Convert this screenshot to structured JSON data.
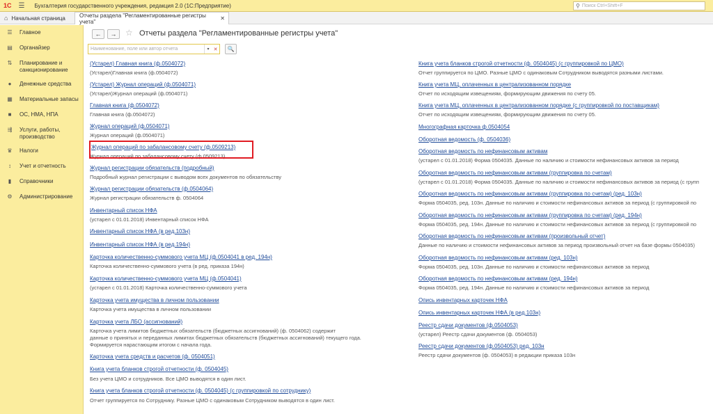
{
  "app": {
    "logo": "1С",
    "title": "Бухгалтерия государственного учреждения, редакция 2.0",
    "mode": "(1С:Предприятие)",
    "search_placeholder": "Поиск Ctrl+Shift+F"
  },
  "tabs": {
    "home": "Начальная страница",
    "active": "Отчеты раздела \"Регламентированные регистры учета\""
  },
  "sidebar": {
    "items": [
      {
        "label": "Главное",
        "icon": "hamburger-icon"
      },
      {
        "label": "Органайзер",
        "icon": "organizer-icon"
      },
      {
        "label": "Планирование и санкционирование",
        "icon": "planning-icon"
      },
      {
        "label": "Денежные средства",
        "icon": "money-icon"
      },
      {
        "label": "Материальные запасы",
        "icon": "materials-icon"
      },
      {
        "label": "ОС, НМА, НПА",
        "icon": "truck-icon"
      },
      {
        "label": "Услуги, работы, производство",
        "icon": "services-icon"
      },
      {
        "label": "Налоги",
        "icon": "taxes-icon"
      },
      {
        "label": "Учет и отчетность",
        "icon": "accounting-icon"
      },
      {
        "label": "Справочники",
        "icon": "book-icon"
      },
      {
        "label": "Администрирование",
        "icon": "gear-icon"
      }
    ]
  },
  "main": {
    "title": "Отчеты раздела \"Регламентированные регистры учета\"",
    "filter_placeholder": "Наименование, поле или автор отчета"
  },
  "left_column": [
    {
      "type": "link",
      "text": "(Устарел) Главная книга (ф.0504072)"
    },
    {
      "type": "desc",
      "text": "(Устарел)Главная книга (ф.0504072)"
    },
    {
      "type": "link",
      "text": "(Устарел) Журнал операций (ф.0504071)"
    },
    {
      "type": "desc",
      "text": "(Устарел)Журнал операций (ф.0504071)"
    },
    {
      "type": "link",
      "text": "Главная книга (ф.0504072)"
    },
    {
      "type": "desc",
      "text": "Главная книга (ф.0504072)"
    },
    {
      "type": "link",
      "text": "Журнал операций (ф.0504071)"
    },
    {
      "type": "desc",
      "text": "Журнал операций (ф.0504071)"
    },
    {
      "type": "link",
      "text": "Журнал операций по забалансовому счету (ф.0509213)"
    },
    {
      "type": "desc",
      "text": "Журнал операций по забалансовому счету (ф.0509213)"
    },
    {
      "type": "link",
      "text": "Журнал регистрации обязательств (подробный)"
    },
    {
      "type": "desc",
      "text": "Подробный журнал регистрации с выводом всех документов по обязательству"
    },
    {
      "type": "link",
      "text": "Журнал регистрации обязательств (ф.0504064)"
    },
    {
      "type": "desc",
      "text": "Журнал регистрации обязательств ф. 0504064"
    },
    {
      "type": "link",
      "text": "Инвентарный список НФА"
    },
    {
      "type": "desc",
      "text": "(устарел с 01.01.2018) Инвентарный список НФА"
    },
    {
      "type": "link",
      "text": "Инвентарный список НФА (в ред.103н)"
    },
    {
      "type": "link",
      "text": "Инвентарный список НФА (в ред.194н)"
    },
    {
      "type": "link",
      "text": "Карточка количественно-суммового учета МЦ  (ф.0504041 в ред. 194н)"
    },
    {
      "type": "desc",
      "text": "Карточка количественно-суммового учета (в ред. приказа 194н)"
    },
    {
      "type": "link",
      "text": "Карточка количественно-суммового учета МЦ  (ф.0504041)"
    },
    {
      "type": "desc",
      "text": "(устарел с 01.01.2018) Карточка количественно-суммового учета"
    },
    {
      "type": "link",
      "text": "Карточка учета имущества в личном пользовании"
    },
    {
      "type": "desc",
      "text": "Карточка учета имущества в личном пользовании"
    },
    {
      "type": "link",
      "text": "Карточка учета ЛБО (ассигнований)"
    },
    {
      "type": "desc",
      "text": "Карточка учета лимитов бюджетных обязательств (бюджетных ассигнований) (ф. 0504062) содержит"
    },
    {
      "type": "desc",
      "text": "данные о принятых и переданных лимитах бюджетных обязательств (бюджетных ассигнований) текущего года."
    },
    {
      "type": "desc",
      "text": "Формируется нарастающим итогом с начала года."
    },
    {
      "type": "link",
      "text": "Карточка учета средств и расчетов (ф. 0504051)"
    },
    {
      "type": "link",
      "text": "Книга учета бланков строгой отчетности (ф. 0504045)"
    },
    {
      "type": "desc",
      "text": "Без учета ЦМО и сотрудников. Все ЦМО выводятся в один лист."
    },
    {
      "type": "link",
      "text": "Книга учета бланков строгой отчетности (ф. 0504045) (с группировкой по сотруднику)"
    },
    {
      "type": "desc",
      "text": "Отчет группируется по Сотруднику. Разные ЦМО с одинаковым Сотрудником выводятся в один лист."
    }
  ],
  "right_column": [
    {
      "type": "link",
      "text": "Книга учета бланков строгой отчетности (ф. 0504045) (с группировкой по ЦМО)"
    },
    {
      "type": "desc",
      "text": "Отчет группируется по ЦМО. Разные ЦМО с одинаковым Сотрудником выводятся разными листами."
    },
    {
      "type": "link",
      "text": "Книга учета МЦ, оплаченных в централизованном порядке"
    },
    {
      "type": "desc",
      "text": "Отчет по исходящим извещениям, формирующим движения по счету 05."
    },
    {
      "type": "link",
      "text": "Книга учета МЦ, оплаченных в централизованном порядке (с группировкой по поставщикам)"
    },
    {
      "type": "desc",
      "text": "Отчет по исходящим извещениям, формирующим движения по счету 05."
    },
    {
      "type": "link",
      "text": "Многографная карточка ф.0504054"
    },
    {
      "type": "link",
      "text": "Оборотная ведомость (ф. 0504036)"
    },
    {
      "type": "link",
      "text": "Оборотная ведомость по нефинансовым активам"
    },
    {
      "type": "desc",
      "text": "(устарел с 01.01.2018) Форма 0504035. Данные по наличию и стоимости нефинансовых активов за период"
    },
    {
      "type": "link",
      "text": "Оборотная ведомость по нефинансовым активам (группировка по счетам)"
    },
    {
      "type": "desc",
      "text": "(устарел с 01.01.2018) Форма 0504035. Данные по наличию и стоимости нефинансовых активов за период (с групп"
    },
    {
      "type": "link",
      "text": "Оборотная ведомость по нефинансовым активам (группировка по счетам) (ред. 103н)"
    },
    {
      "type": "desc",
      "text": "Форма 0504035, ред. 103н. Данные по наличию и стоимости нефинансовых активов за период (с группировкой по"
    },
    {
      "type": "link",
      "text": "Оборотная ведомость по нефинансовым активам (группировка по счетам) (ред. 194н)"
    },
    {
      "type": "desc",
      "text": "Форма 0504035, ред. 194н. Данные по наличию и стоимости нефинансовых активов за период (с группировкой по"
    },
    {
      "type": "link",
      "text": "Оборотная ведомость по нефинансовым активам (произвольный отчет)"
    },
    {
      "type": "desc",
      "text": "Данные по наличию и стоимости нефинансовых активов за период произвольный отчет на базе формы 0504035)"
    },
    {
      "type": "link",
      "text": "Оборотная ведомость по нефинансовым активам (ред. 103н)"
    },
    {
      "type": "desc",
      "text": "Форма 0504035, ред. 103н. Данные по наличию и стоимости нефинансовых активов за период"
    },
    {
      "type": "link",
      "text": "Оборотная ведомость по нефинансовым активам (ред. 194н)"
    },
    {
      "type": "desc",
      "text": "Форма 0504035, ред. 194н. Данные по наличию и стоимости нефинансовых активов за период"
    },
    {
      "type": "link",
      "text": "Опись инвентарных карточек НФА"
    },
    {
      "type": "link",
      "text": "Опись инвентарных карточек НФА (в ред.103н)"
    },
    {
      "type": "link",
      "text": "Реестр сдачи документов (ф.0504053)"
    },
    {
      "type": "desc",
      "text": "(устарел) Реестр сдачи документов (ф. 0504053)"
    },
    {
      "type": "link",
      "text": "Реестр сдачи документов (ф.0504053) ред. 103н"
    },
    {
      "type": "desc",
      "text": "Реестр сдачи документов (ф. 0504053) в редакции приказа 103н"
    }
  ],
  "highlight_color": "#e01b22",
  "accent_color": "#fbed9e"
}
